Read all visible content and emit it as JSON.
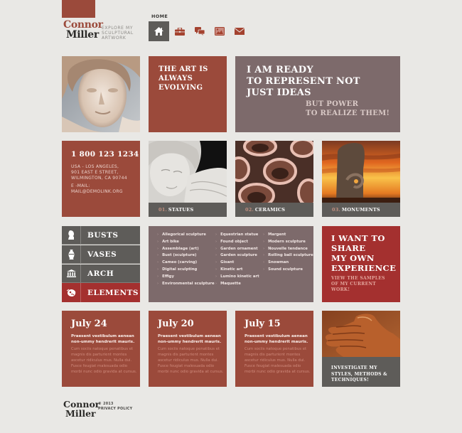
{
  "brand": {
    "first_name": "Connor",
    "last_name": "Miller",
    "tagline_lines": [
      "EXPLORE MY",
      "SCULPTURAL",
      "ARTWORK"
    ],
    "accent_color": "#9b4a3b"
  },
  "nav": {
    "active_label": "HOME",
    "items": [
      {
        "icon": "home-icon",
        "label": "HOME",
        "active": true
      },
      {
        "icon": "briefcase-icon",
        "active": false
      },
      {
        "icon": "chat-bubbles-icon",
        "active": false
      },
      {
        "icon": "gallery-image-icon",
        "active": false
      },
      {
        "icon": "envelope-icon",
        "active": false
      }
    ]
  },
  "hero": {
    "art_evolving": [
      "THE ART IS",
      "ALWAYS",
      "EVOLVING"
    ],
    "ready_main": [
      "I AM READY",
      "TO REPRESENT NOT",
      "JUST IDEAS"
    ],
    "ready_sub": [
      "BUT POWER",
      "TO REALIZE THEM!"
    ]
  },
  "contact": {
    "phone": "1 800 123 1234",
    "address_lines": [
      "USA - LOS ANGELES,",
      "901 EAST E STREET,",
      "WILMINGTON, CA 90744"
    ],
    "email_label": "E -MAIL:",
    "email": "MAIL@DEMOLINK.ORG"
  },
  "categories": [
    {
      "num": "01.",
      "label": "STATUES"
    },
    {
      "num": "02.",
      "label": "CERAMICS"
    },
    {
      "num": "03.",
      "label": "MONUMENTS"
    }
  ],
  "menu": [
    {
      "label": "BUSTS",
      "icon": "bust-icon",
      "active": false
    },
    {
      "label": "VASES",
      "icon": "vase-icon",
      "active": false
    },
    {
      "label": "ARCH",
      "icon": "temple-arch-icon",
      "active": false
    },
    {
      "label": "ELEMENTS",
      "icon": "elements-icon",
      "active": true
    }
  ],
  "sculpture_list": {
    "col1": [
      "Allegorical sculpture",
      "Art bike",
      "Assemblage (art)",
      "Bust (sculpture)",
      "Cameo (carving)",
      "Digital sculpting",
      "Effigy",
      "Environmental sculpture"
    ],
    "col2": [
      "Equestrian statue",
      "Found object",
      "Garden ornament",
      "Garden sculpture",
      "Gisant",
      "Kinetic art",
      "Lumino kinetic art",
      "Maquette"
    ],
    "col3": [
      "Margent",
      "Modern sculpture",
      "Nouvelle tendance",
      "Rolling ball sculpture",
      "Snowman",
      "Sound sculpture"
    ]
  },
  "share": {
    "main": [
      "I WANT TO",
      "SHARE",
      "MY OWN",
      "EXPERIENCE"
    ],
    "sub": [
      "VIEW THE SAMPLES",
      "OF MY CURRENT",
      "WORK!"
    ]
  },
  "news": [
    {
      "date": "July 24",
      "lead": "Praesent vestibulum aenean non-ummy hendrerit mauris.",
      "body": "Cum sociis natoque penatibus et magnis dis parturient montes ascetur ridiculus mus. Nulla dui. Fusce feugiat malesuada odio morbi nunc odio gravida at cursus."
    },
    {
      "date": "July 20",
      "lead": "Praesent vestibulum aenean non-ummy hendrerit mauris.",
      "body": "Cum sociis natoque penatibus et magnis dis parturient montes ascetur ridiculus mus. Nulla dui. Fusce feugiat malesuada odio morbi nunc odio gravida at cursus."
    },
    {
      "date": "July 15",
      "lead": "Praesent vestibulum aenean non-ummy hendrerit mauris.",
      "body": "Cum sociis natoque penatibus et magnis dis parturient montes ascetur ridiculus mus. Nulla dui. Fusce feugiat malesuada odio morbi nunc odio gravida at cursus."
    }
  ],
  "investigate": {
    "lines": [
      "INVESTIGATE MY",
      "STYLES, METHODS &",
      "TECHNIQUES!"
    ]
  },
  "footer": {
    "first_name": "Connor",
    "last_name": "Miller",
    "copyright": "© 2013",
    "privacy": "PRIVACY POLICY"
  }
}
